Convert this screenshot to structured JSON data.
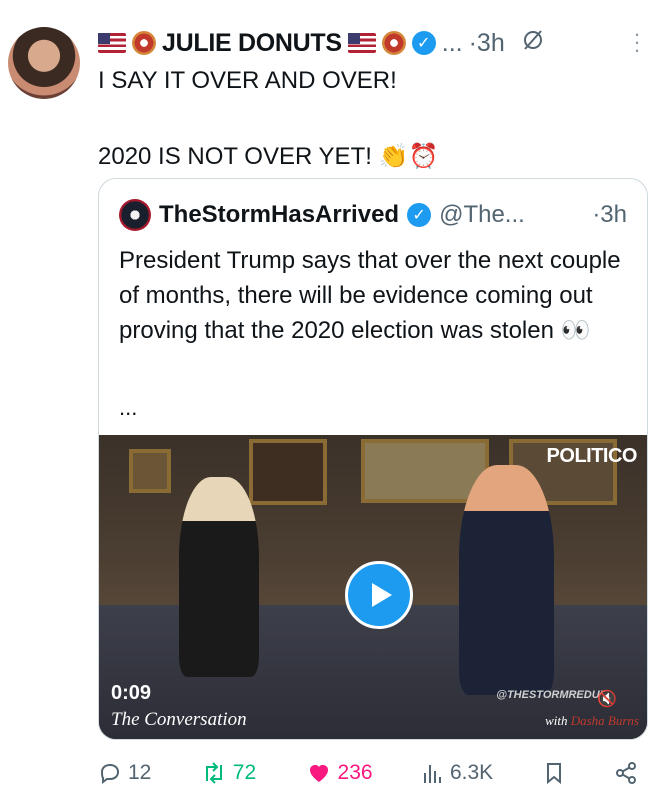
{
  "post": {
    "author_name": "JULIE DONUTS",
    "time": "·3h",
    "ellipsis": "...",
    "text": "I SAY IT OVER AND OVER!\n\n2020 IS NOT OVER YET! 👏⏰"
  },
  "quote": {
    "author_name": "TheStormHasArrived",
    "handle": "@The...",
    "time": "·3h",
    "text": "President Trump says that over the next couple of months, there will be evidence coming out proving that the 2020 election was stolen 👀",
    "ellipsis": "...",
    "video": {
      "brand": "POLITICO",
      "duration": "0:09",
      "caption": "The Conversation",
      "watermark": "@THESTORMREDUX",
      "credit_prefix": "with",
      "credit_name": "Dasha Burns"
    }
  },
  "actions": {
    "replies": "12",
    "reposts": "72",
    "likes": "236",
    "views": "6.3K"
  },
  "colors": {
    "verified": "#1d9bf0",
    "repost": "#00ba7c",
    "like": "#f91880"
  },
  "icons": [
    "verified-badge-icon",
    "grok-icon",
    "more-icon",
    "reply-icon",
    "repost-icon",
    "like-icon",
    "views-icon",
    "bookmark-icon",
    "share-icon",
    "play-icon",
    "mute-icon"
  ]
}
